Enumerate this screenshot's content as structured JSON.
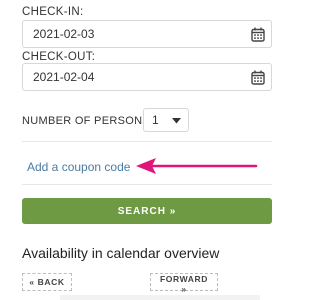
{
  "checkin": {
    "label": "CHECK-IN:",
    "value": "2021-02-03"
  },
  "checkout": {
    "label": "CHECK-OUT:",
    "value": "2021-02-04"
  },
  "persons": {
    "label": "NUMBER OF PERSONS:",
    "value": "1"
  },
  "coupon": {
    "link_text": "Add a coupon code"
  },
  "search": {
    "label": "SEARCH »"
  },
  "availability": {
    "title": "Availability in calendar overview",
    "back_label": "« BACK",
    "forward_label": "FORWARD »"
  },
  "colors": {
    "search_button": "#6e9a44",
    "coupon_link": "#4b7ca3",
    "annotation_arrow": "#e0177a"
  },
  "icons": {
    "date_picker": "calendar-icon",
    "select": "caret-down-icon",
    "annotation": "arrow-left-icon"
  }
}
